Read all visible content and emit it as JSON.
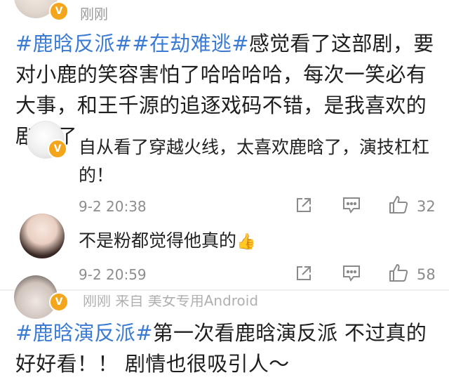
{
  "post1": {
    "time": "刚刚",
    "tag1": "#鹿晗反派#",
    "tag2": "#在劫难逃#",
    "text": "感觉看了这部剧，要对小鹿的笑容害怕了哈哈哈哈，每次一笑必有大事，和王千源的追逐戏码不错，是我喜欢的剧情了"
  },
  "reply1": {
    "text": "自从看了穿越火线，太喜欢鹿晗了，演技杠杠的！",
    "time": "9-2 20:38",
    "likes": "32"
  },
  "reply2": {
    "text": "不是粉都觉得他真的",
    "emoji": "👍",
    "time": "9-2 20:59",
    "likes": "58"
  },
  "post2": {
    "meta": "刚刚 来自 美女专用Android",
    "tag": "#鹿晗演反派#",
    "text": "第一次看鹿晗演反派 不过真的好好看！！ 剧情也很吸引人～"
  },
  "icons": {
    "verified": "verified-v-badge",
    "share": "share-icon",
    "comment": "comment-icon",
    "like": "thumbs-up-icon"
  },
  "colors": {
    "hashtag": "#3b7bd4",
    "verified_badge": "#f3a51c",
    "muted_text": "#8d8d8d"
  }
}
